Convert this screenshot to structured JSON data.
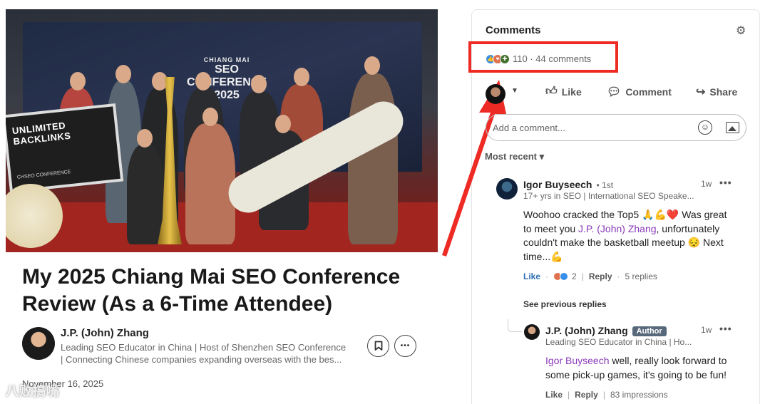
{
  "article": {
    "hero_texts": {
      "banner_top": "CHIANG MAI",
      "banner_main": "SEO CONFERENCE 2025",
      "cheque": "UNLIMITED BACKLINKS",
      "cheque_sub": "CHSEO CONFERENCE"
    },
    "title": "My 2025 Chiang Mai SEO Conference Review (As a 6-Time Attendee)",
    "author": {
      "name": "J.P. (John) Zhang",
      "bio_line1": "Leading SEO Educator in China | Host of Shenzhen SEO Conference",
      "bio_line2": "| Connecting Chinese companies expanding overseas with the bes..."
    },
    "save_icon": "bookmark-icon",
    "more_icon": "more-horizontal-icon",
    "more_label": "•••",
    "date": "November 16, 2025",
    "watermark": "八败搞嘴"
  },
  "comments_panel": {
    "title": "Comments",
    "settings_icon": "gear-icon",
    "reactions_summary": "110 · 44 comments",
    "actions": {
      "like": "Like",
      "comment": "Comment",
      "share": "Share"
    },
    "add_comment_placeholder": "Add a comment...",
    "sort_label": "Most recent ▾",
    "comments": [
      {
        "name": "Igor Buyseech",
        "degree": "• 1st",
        "subtitle": "17+ yrs in SEO | International SEO Speake...",
        "time": "1w",
        "body_pre": "Woohoo cracked the Top5 🙏💪❤️ Was great to meet you ",
        "mention": "J.P. (John) Zhang",
        "body_post": ", unfortunately couldn't make the basketball meetup 😔 Next time...💪",
        "like_label": "Like",
        "reaction_count": "2",
        "reply_label": "Reply",
        "replies_count": "5 replies"
      }
    ],
    "see_previous": "See previous replies",
    "reply": {
      "name": "J.P. (John) Zhang",
      "badge": "Author",
      "subtitle": "Leading SEO Educator in China | Ho...",
      "time": "1w",
      "mention": "Igor Buyseech",
      "body_post": " well, really look forward to some pick-up games, it's going to be fun!",
      "like_label": "Like",
      "reply_label": "Reply",
      "impressions": "83 impressions"
    }
  },
  "colors": {
    "highlight": "#ee2a24",
    "mention": "#8a3ab9",
    "like_link": "#2d6fb7",
    "author_badge": "#56687a"
  }
}
